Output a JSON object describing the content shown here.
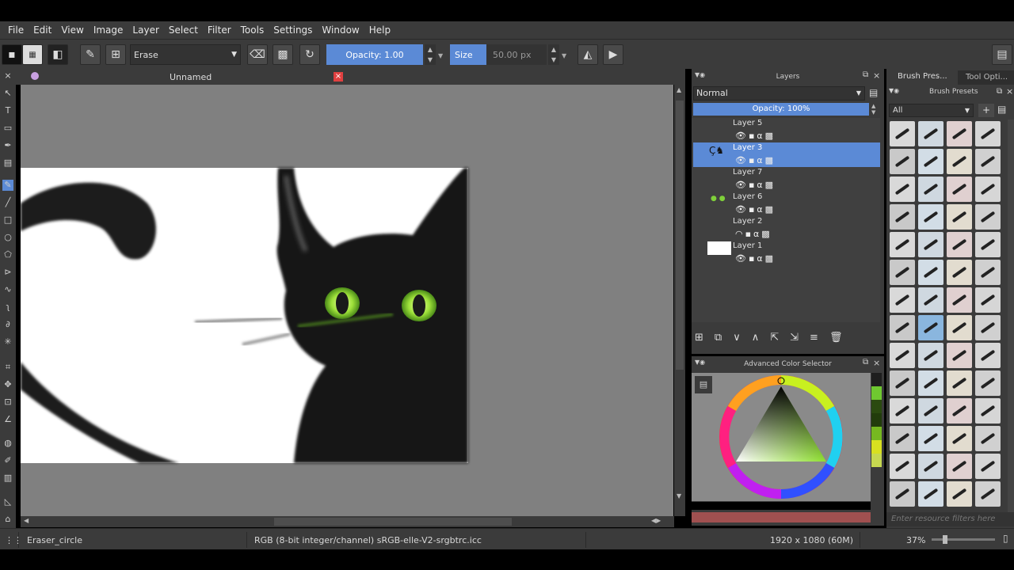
{
  "menu": [
    "File",
    "Edit",
    "View",
    "Image",
    "Layer",
    "Select",
    "Filter",
    "Tools",
    "Settings",
    "Window",
    "Help"
  ],
  "toolbar": {
    "blend_mode": "Erase",
    "opacity_label": "Opacity:",
    "opacity_value": "1.00",
    "size_label": "Size",
    "size_value": "50.00 px"
  },
  "document": {
    "tab_title": "Unnamed"
  },
  "layers_panel": {
    "title": "Layers",
    "blend_mode": "Normal",
    "opacity": "Opacity:  100%",
    "layers": [
      {
        "name": "Layer 5"
      },
      {
        "name": "Layer 3",
        "selected": true
      },
      {
        "name": "Layer 7"
      },
      {
        "name": "Layer 6"
      },
      {
        "name": "Layer 2"
      },
      {
        "name": "Layer 1"
      }
    ]
  },
  "color_selector": {
    "title": "Advanced Color Selector"
  },
  "right_tabs": {
    "tab1": "Brush Pres...",
    "tab2": "Tool Opti..."
  },
  "brush_presets": {
    "title": "Brush Presets",
    "filter": "All",
    "search_placeholder": "Enter resource filters here"
  },
  "status": {
    "brush": "Eraser_circle",
    "color_profile": "RGB (8-bit integer/channel)  sRGB-elle-V2-srgbtrc.icc",
    "dimensions": "1920 x 1080 (60M)",
    "zoom": "37%"
  },
  "colors": {
    "accent": "#5b8ad6",
    "panel": "#3b3b3b",
    "canvas_bg": "#808080"
  }
}
